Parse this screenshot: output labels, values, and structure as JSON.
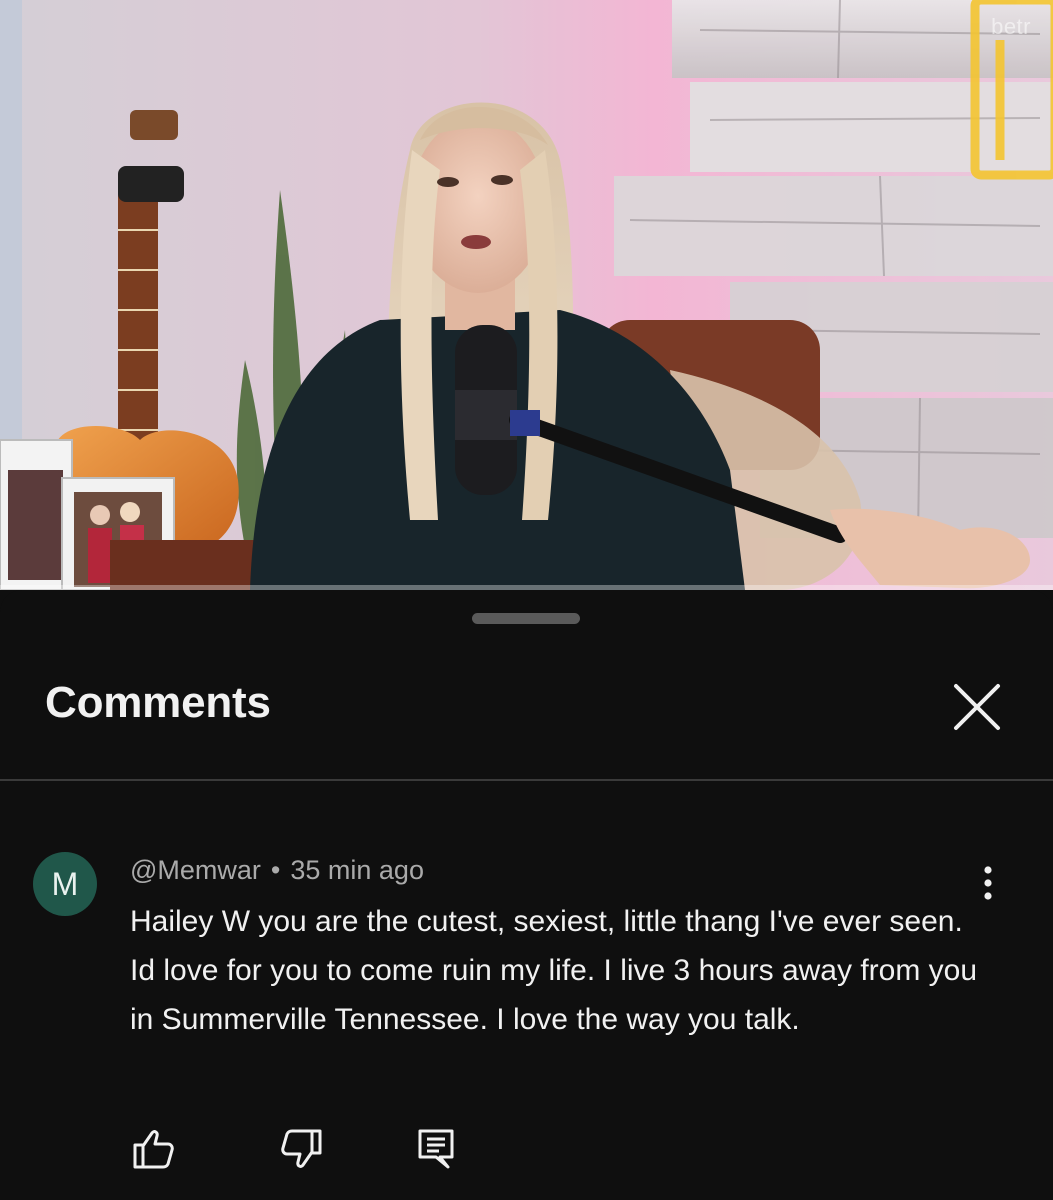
{
  "video": {
    "watermark": "betr",
    "neon_color": "#f4c531"
  },
  "comments_sheet": {
    "title": "Comments",
    "close_icon": "close-icon"
  },
  "comment": {
    "avatar_letter": "M",
    "avatar_color": "#20574a",
    "author": "@Memwar",
    "separator": "•",
    "time": "35 min ago",
    "text": "Hailey W you are the cutest, sexiest, little thang I've ever seen. Id love for you to come ruin my life.  I live 3 hours away from you in Summerville Tennessee. I love the way you talk.",
    "actions": {
      "like_icon": "thumbs-up-icon",
      "dislike_icon": "thumbs-down-icon",
      "reply_icon": "reply-icon",
      "menu_icon": "more-vert-icon"
    }
  }
}
